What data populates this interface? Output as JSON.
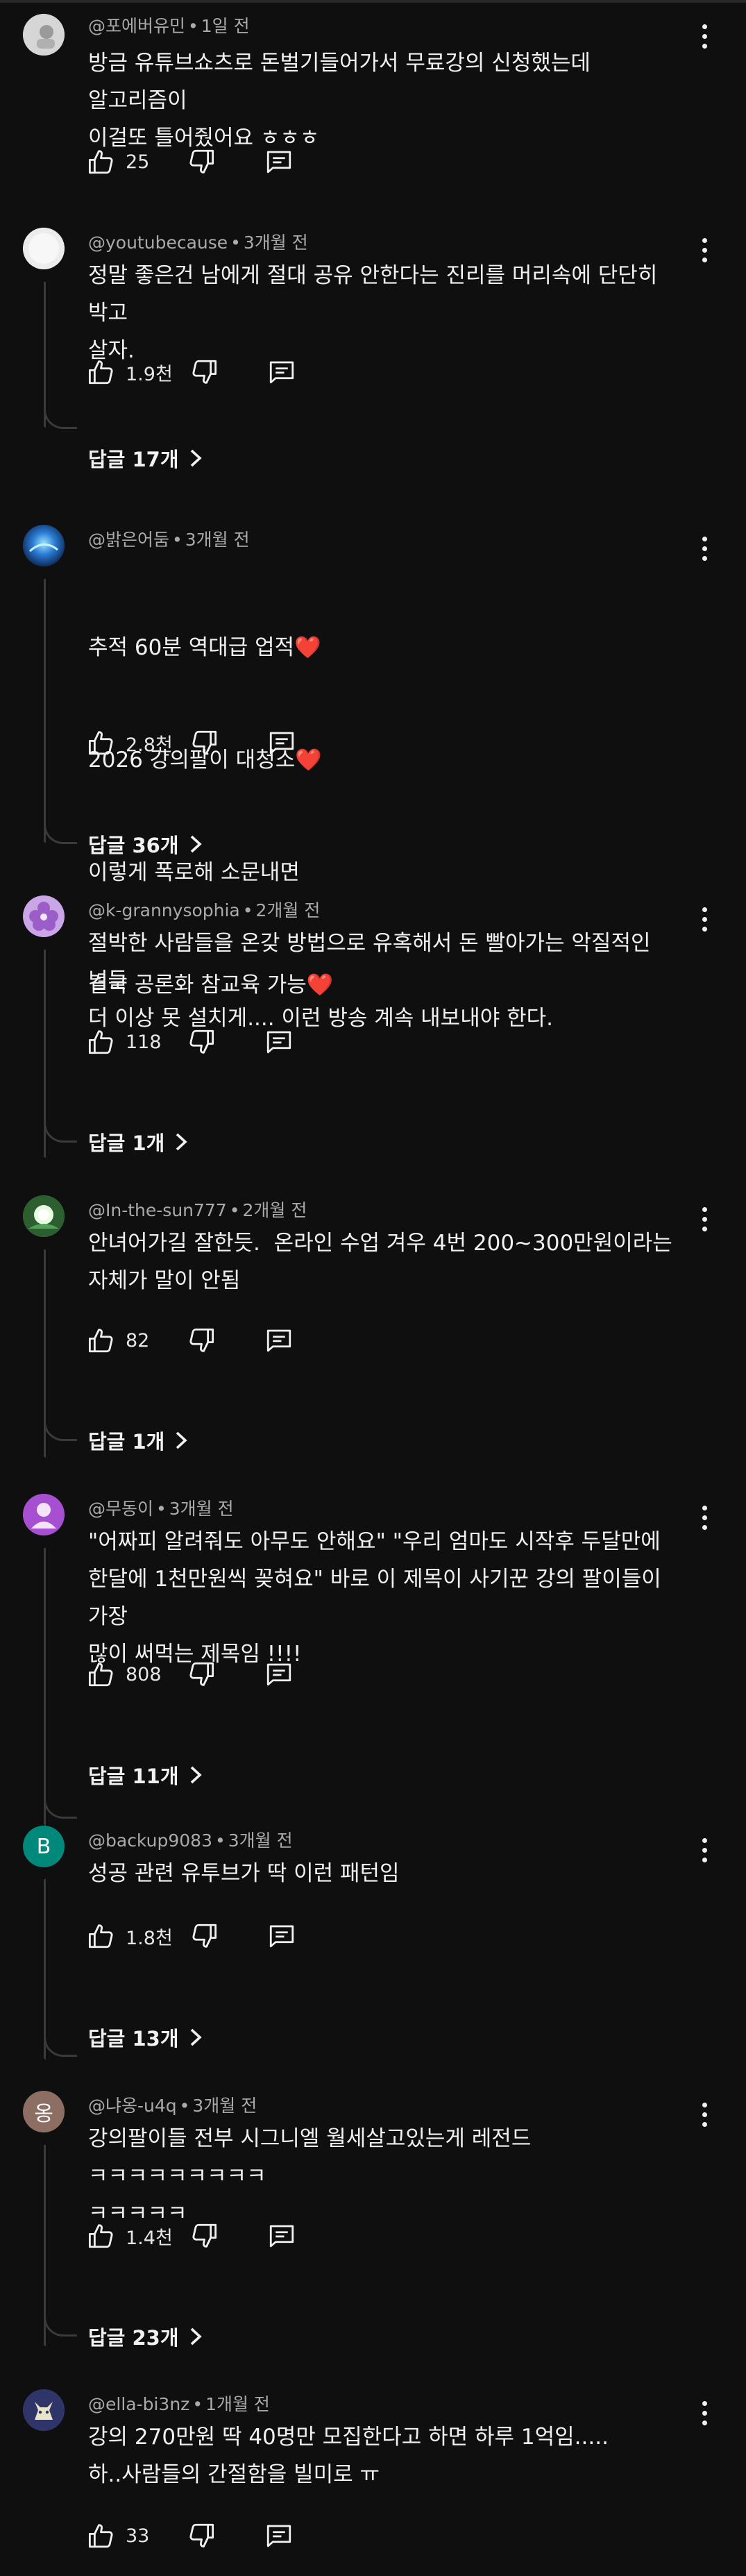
{
  "colors": {
    "background": "#0f0f0f",
    "text": "#f1f1f1",
    "meta_text": "#aaaaaa",
    "thread_line": "#3a3a3a",
    "heart": "#ff4c7c"
  },
  "icons": {
    "like": "thumbs-up-icon",
    "dislike": "thumbs-down-icon",
    "reply": "comment-reply-icon",
    "more": "more-vert-icon",
    "chevron": "chevron-right-icon"
  },
  "comments": [
    {
      "author": "@포에버유민",
      "time": "1일 전",
      "avatar": {
        "letter": "",
        "color": "#cfcfcf"
      },
      "text": "방금 유튜브쇼츠로 돈벌기들어가서 무료강의 신청했는데 알고리즘이\n이걸또 틀어줬어요 ㅎㅎㅎ",
      "likes": "25",
      "replies": ""
    },
    {
      "author": "@youtubecause",
      "time": "3개월 전",
      "avatar": {
        "letter": "",
        "color": "#e8e8e8"
      },
      "text": "정말 좋은건 남에게 절대 공유 안한다는 진리를 머리속에 단단히 박고\n살자.",
      "likes": "1.9천",
      "replies": "답글 17개"
    },
    {
      "author": "@밝은어둠",
      "time": "3개월 전",
      "avatar": {
        "letter": "",
        "color": "#1d4f8f"
      },
      "text_lines": [
        {
          "text": "추적 60분 역대급 업적",
          "heart": "❤️"
        },
        {
          "text": "2026 강의팔이 대청소",
          "heart": "❤️"
        },
        {
          "text": "이렇게 폭로해 소문내면",
          "heart": ""
        },
        {
          "text": "결국 공론화 참교육 가능",
          "heart": "❤️"
        }
      ],
      "likes": "2.8천",
      "replies": "답글 36개"
    },
    {
      "author": "@k-grannysophia",
      "time": "2개월 전",
      "avatar": {
        "letter": "",
        "color": "#8a5fb2"
      },
      "text": "절박한 사람들을 온갖 방법으로 유혹해서 돈 빨아가는 악질적인 넘들\n더 이상 못 설치게.... 이런 방송 계속 내보내야 한다.",
      "likes": "118",
      "replies": "답글 1개"
    },
    {
      "author": "@In-the-sun777",
      "time": "2개월 전",
      "avatar": {
        "letter": "",
        "color": "#3f8a4a"
      },
      "text": "안녀어가길 잘한듯.  온라인 수업 겨우 4번 200~300만원이라는\n자체가 말이 안됨",
      "likes": "82",
      "replies": "답글 1개"
    },
    {
      "author": "@무동이",
      "time": "3개월 전",
      "avatar": {
        "letter": "",
        "color": "#9b3fc4"
      },
      "text": "\"어짜피 알려줘도 아무도 안해요\" \"우리 엄마도 시작후 두달만에\n한달에 1천만원씩 꽂혀요\" 바로 이 제목이 사기꾼 강의 팔이들이 가장\n많이 써먹는 제목임 !!!!",
      "likes": "808",
      "replies": "답글 11개"
    },
    {
      "author": "@backup9083",
      "time": "3개월 전",
      "avatar": {
        "letter": "B",
        "color": "#00897b"
      },
      "text": "성공 관련 유투브가 딱 이런 패턴임",
      "likes": "1.8천",
      "replies": "답글 13개"
    },
    {
      "author": "@냐옹-u4q",
      "time": "3개월 전",
      "avatar": {
        "letter": "옹",
        "color": "#8d6e63"
      },
      "text": "강의팔이들 전부 시그니엘 월세살고있는게 레전드 ㅋㅋㅋㅋㅋㅋㅋㅋㅋ\nㅋㅋㅋㅋㅋ",
      "likes": "1.4천",
      "replies": "답글 23개"
    },
    {
      "author": "@ella-bi3nz",
      "time": "1개월 전",
      "avatar": {
        "letter": "",
        "color": "#3a3f73"
      },
      "text": "강의 270만원 딱 40명만 모집한다고 하면 하루 1억임.....\n하..사람들의 간절함을 빌미로 ㅠ",
      "likes": "33",
      "replies": ""
    }
  ]
}
